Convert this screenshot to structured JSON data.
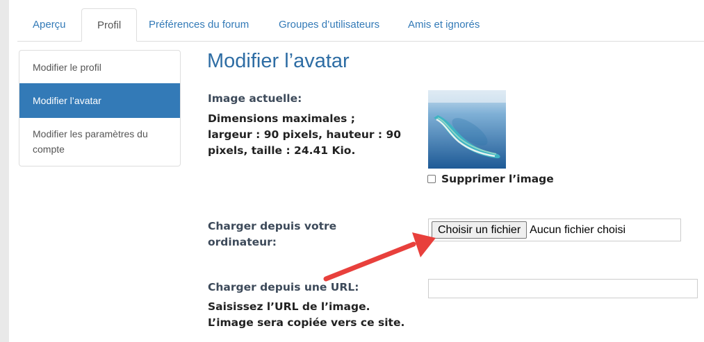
{
  "tabs": [
    {
      "label": "Aperçu",
      "active": false
    },
    {
      "label": "Profil",
      "active": true
    },
    {
      "label": "Préférences du forum",
      "active": false
    },
    {
      "label": "Groupes d’utilisateurs",
      "active": false
    },
    {
      "label": "Amis et ignorés",
      "active": false
    }
  ],
  "sidebar": {
    "items": [
      {
        "label": "Modifier le profil",
        "active": false
      },
      {
        "label": "Modifier l’avatar",
        "active": true
      },
      {
        "label": "Modifier les paramètres du compte",
        "active": false
      }
    ]
  },
  "main": {
    "title": "Modifier l’avatar",
    "current_image_label": "Image actuelle:",
    "dimensions_text_line1": "Dimensions maximales ;",
    "dimensions_text_line2": "largeur : 90 pixels, hauteur : 90",
    "dimensions_text_line3": "pixels, taille : 24.41 Kio.",
    "delete_image_label": "Supprimer l’image",
    "upload_local_label_line1": "Charger depuis votre",
    "upload_local_label_line2": "ordinateur:",
    "choose_file_button": "Choisir un fichier",
    "no_file_chosen": "Aucun fichier choisi",
    "upload_url_label": "Charger depuis une URL:",
    "url_help_line1": "Saisissez l’URL de l’image.",
    "url_help_line2": "L’image sera copiée vers ce site.",
    "url_input_value": ""
  },
  "colors": {
    "link": "#337ab7",
    "active_nav_bg": "#337ab7",
    "title": "#2e6da4",
    "annotation_arrow": "#e8403c"
  },
  "icons": {
    "avatar": "atoll-aerial-photo",
    "annotation": "red-arrow"
  }
}
